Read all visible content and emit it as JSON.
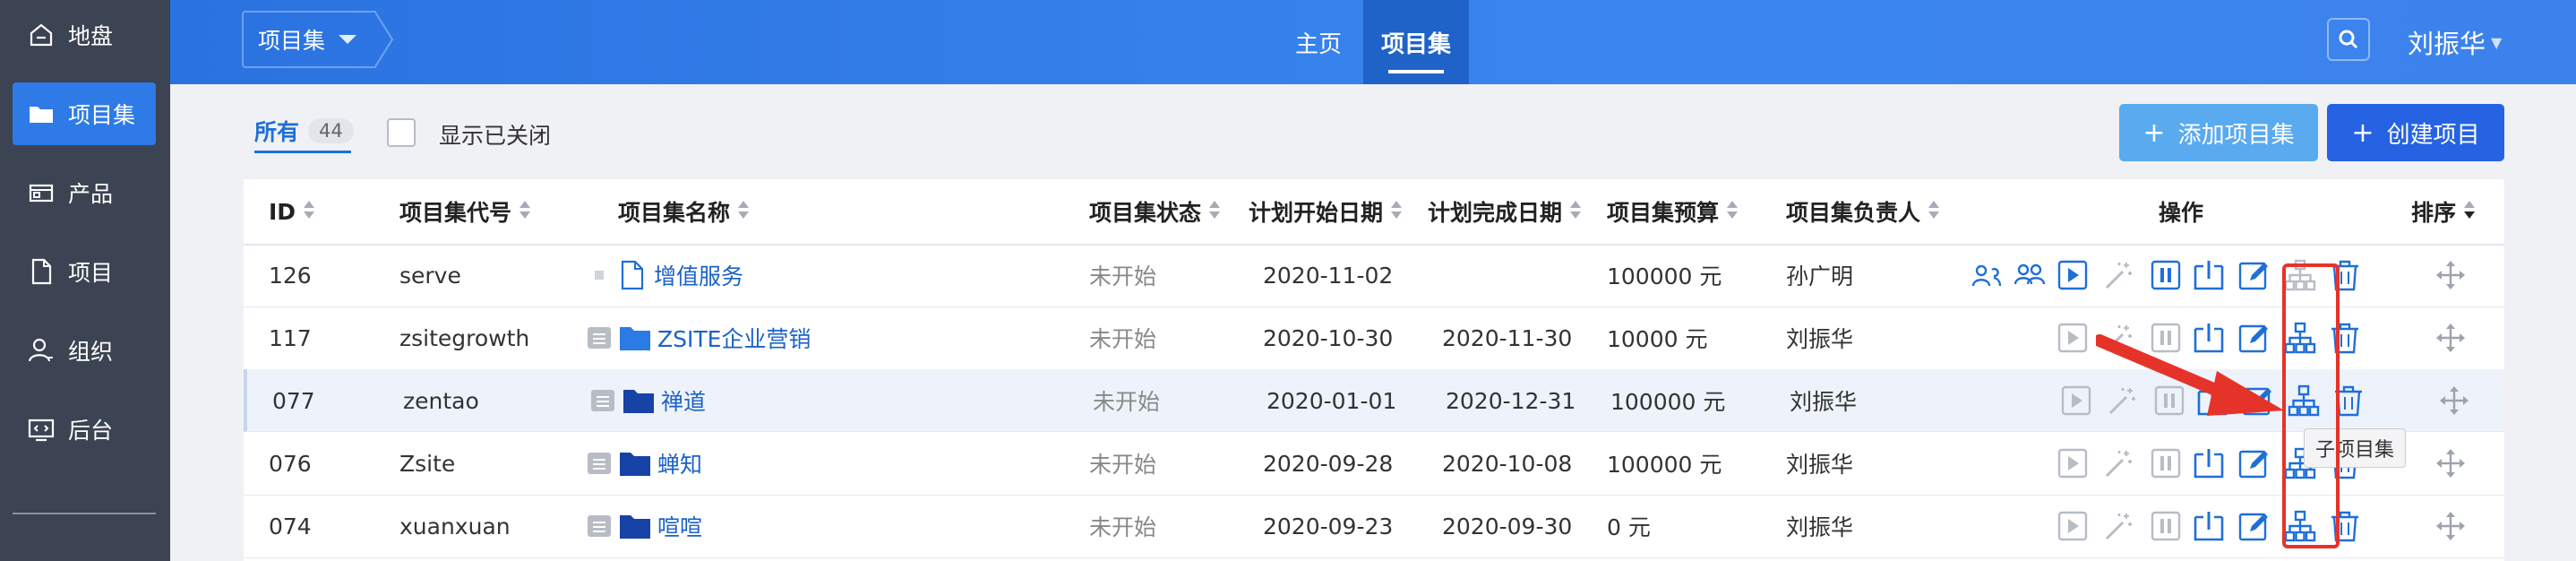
{
  "sidebar": {
    "items": [
      {
        "label": "地盘",
        "icon": "home-icon",
        "active": false
      },
      {
        "label": "项目集",
        "icon": "folder-icon",
        "active": true
      },
      {
        "label": "产品",
        "icon": "product-icon",
        "active": false
      },
      {
        "label": "项目",
        "icon": "file-icon",
        "active": false
      },
      {
        "label": "组织",
        "icon": "user-icon",
        "active": false
      },
      {
        "label": "后台",
        "icon": "monitor-icon",
        "active": false
      }
    ]
  },
  "header": {
    "breadcrumb": "项目集",
    "nav_home": "主页",
    "nav_active": "项目集",
    "user": "刘振华"
  },
  "toolbar": {
    "tab_all": "所有",
    "tab_count": "44",
    "show_closed": "显示已关闭",
    "add_program": "添加项目集",
    "create_project": "创建项目"
  },
  "table": {
    "columns": {
      "id": "ID",
      "code": "项目集代号",
      "name": "项目集名称",
      "status": "项目集状态",
      "begin": "计划开始日期",
      "end": "计划完成日期",
      "budget": "项目集预算",
      "pm": "项目集负责人",
      "actions": "操作",
      "order": "排序"
    },
    "rows": [
      {
        "id": "126",
        "code": "serve",
        "name": "增值服务",
        "status": "未开始",
        "begin": "2020-11-02",
        "end": "",
        "budget": "100000 元",
        "pm": "孙广明",
        "kind": "file"
      },
      {
        "id": "117",
        "code": "zsitegrowth",
        "name": "ZSITE企业营销",
        "status": "未开始",
        "begin": "2020-10-30",
        "end": "2020-11-30",
        "budget": "10000 元",
        "pm": "刘振华",
        "kind": "folder"
      },
      {
        "id": "077",
        "code": "zentao",
        "name": "禅道",
        "status": "未开始",
        "begin": "2020-01-01",
        "end": "2020-12-31",
        "budget": "100000 元",
        "pm": "刘振华",
        "kind": "folder"
      },
      {
        "id": "076",
        "code": "Zsite",
        "name": "蝉知",
        "status": "未开始",
        "begin": "2020-09-28",
        "end": "2020-10-08",
        "budget": "100000 元",
        "pm": "刘振华",
        "kind": "folder"
      },
      {
        "id": "074",
        "code": "xuanxuan",
        "name": "喧喧",
        "status": "未开始",
        "begin": "2020-09-23",
        "end": "2020-09-30",
        "budget": "0 元",
        "pm": "刘振华",
        "kind": "folder"
      }
    ]
  },
  "tooltip": "子项目集",
  "colors": {
    "accent": "#2e7ae6",
    "link": "#1a62c8",
    "highlight": "#e63329"
  }
}
